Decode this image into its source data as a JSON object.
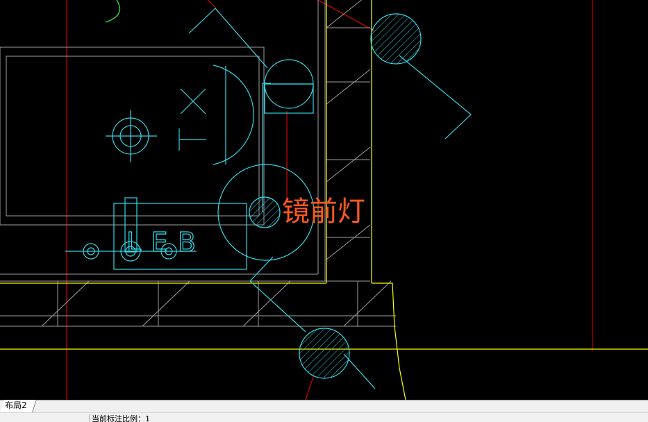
{
  "drawing": {
    "fixture_label": "镜前灯",
    "panel_text": "LEB"
  },
  "tabs": {
    "layout_tab": "布局2"
  },
  "status": {
    "scale_text": "当前标注比例：1"
  },
  "colors": {
    "background": "#000000",
    "cyan": "#30d8e8",
    "yellow": "#ffff00",
    "red": "#ff0000",
    "gray": "#9a9a9a",
    "orange_text": "#ff5a1e",
    "green": "#2ecc40"
  }
}
